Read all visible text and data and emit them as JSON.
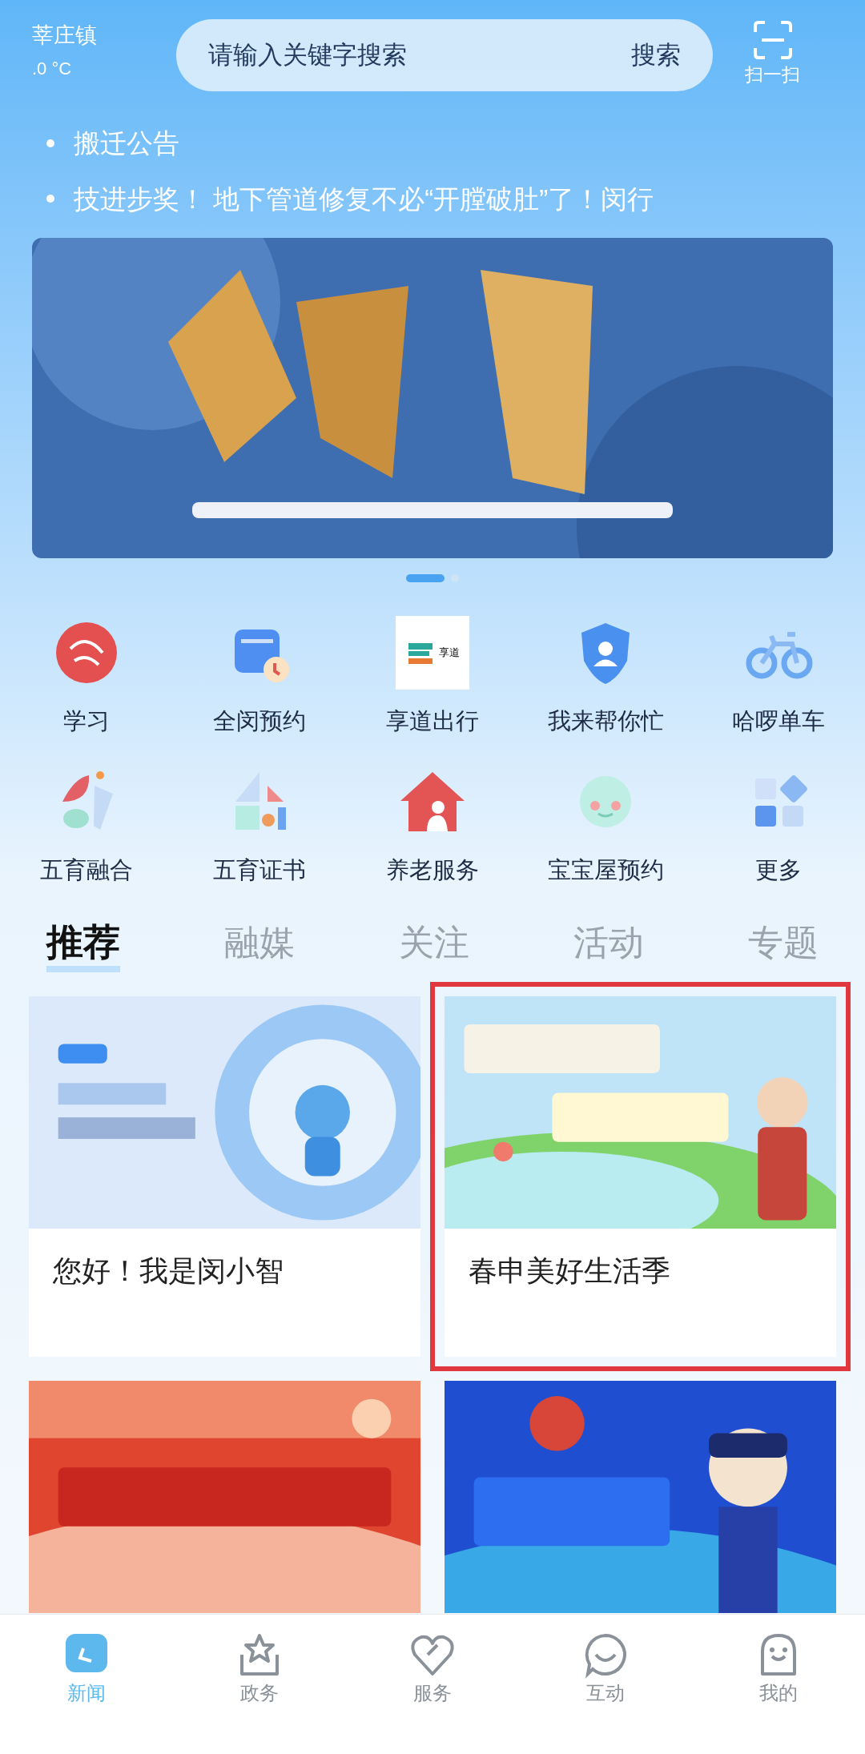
{
  "header": {
    "location": "莘庄镇",
    "temperature": ".0 °C",
    "search": {
      "placeholder": "请输入关键字搜索",
      "button": "搜索"
    },
    "scan": "扫一扫"
  },
  "news": [
    "搬迁公告",
    "技进步奖！ 地下管道修复不必“开膛破肚”了！闵行"
  ],
  "banner": {
    "kind": "picture",
    "pages": [
      {
        "selected": true
      },
      {
        "selected": false
      }
    ]
  },
  "shortcuts": [
    {
      "label": "学习"
    },
    {
      "label": "全闵预约"
    },
    {
      "label": "享道出行",
      "logo_text": "享道"
    },
    {
      "label": "我来帮你忙"
    },
    {
      "label": "哈啰单车"
    },
    {
      "label": "五育融合"
    },
    {
      "label": "五育证书"
    },
    {
      "label": "养老服务"
    },
    {
      "label": "宝宝屋预约"
    },
    {
      "label": "更多"
    }
  ],
  "tabs": [
    {
      "label": "推荐",
      "selected": true
    },
    {
      "label": "融媒",
      "selected": false
    },
    {
      "label": "关注",
      "selected": false
    },
    {
      "label": "活动",
      "selected": false
    },
    {
      "label": "专题",
      "selected": false
    }
  ],
  "cards": [
    {
      "title": "您好！我是闵小智",
      "outlined": false
    },
    {
      "title": "春申美好生活季",
      "outlined": true
    },
    {
      "outlined": false
    },
    {
      "outlined": false
    }
  ],
  "nav": [
    {
      "label": "新闻",
      "selected": true
    },
    {
      "label": "政务",
      "selected": false
    },
    {
      "label": "服务",
      "selected": false
    },
    {
      "label": "互动",
      "selected": false
    },
    {
      "label": "我的",
      "selected": false
    }
  ]
}
